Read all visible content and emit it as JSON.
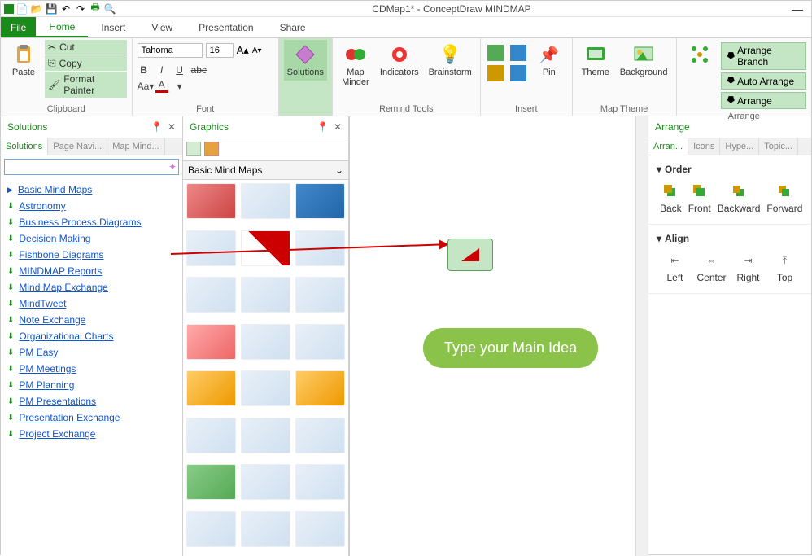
{
  "window": {
    "title": "CDMap1* - ConceptDraw MINDMAP"
  },
  "menu": {
    "file": "File",
    "tabs": [
      "Home",
      "Insert",
      "View",
      "Presentation",
      "Share"
    ]
  },
  "ribbon": {
    "clipboard": {
      "label": "Clipboard",
      "paste": "Paste",
      "cut": "Cut",
      "copy": "Copy",
      "fmt": "Format Painter"
    },
    "font": {
      "label": "Font",
      "family": "Tahoma",
      "size": "16"
    },
    "solutions": {
      "label": "Solutions"
    },
    "remind": {
      "label": "Remind Tools",
      "map": "Map\nMinder",
      "ind": "Indicators",
      "brain": "Brainstorm"
    },
    "insert": {
      "label": "Insert",
      "pin": "Pin"
    },
    "theme": {
      "label": "Map Theme",
      "theme": "Theme",
      "bg": "Background"
    },
    "arrange": {
      "label": "Arrange",
      "branch": "Arrange Branch",
      "auto": "Auto Arrange",
      "arr": "Arrange"
    }
  },
  "solutions": {
    "title": "Solutions",
    "tabs": [
      "Solutions",
      "Page Navi...",
      "Map Mind..."
    ],
    "head": "Basic Mind Maps",
    "items": [
      "Astronomy",
      "Business Process Diagrams",
      "Decision Making",
      "Fishbone Diagrams",
      "MINDMAP Reports",
      "Mind Map Exchange",
      "MindTweet",
      "Note Exchange",
      "Organizational Charts",
      "PM Easy",
      "PM Meetings",
      "PM Planning",
      "PM Presentations",
      "Presentation Exchange",
      "Project Exchange"
    ]
  },
  "graphics": {
    "title": "Graphics",
    "cat": "Basic Mind Maps"
  },
  "canvas": {
    "main": "Type your Main Idea"
  },
  "arrange": {
    "title": "Arrange",
    "tabs": [
      "Arran...",
      "Icons",
      "Hype...",
      "Topic..."
    ],
    "order": {
      "title": "Order",
      "back": "Back",
      "front": "Front",
      "backward": "Backward",
      "forward": "Forward"
    },
    "align": {
      "title": "Align",
      "left": "Left",
      "center": "Center",
      "right": "Right",
      "top": "Top"
    }
  }
}
